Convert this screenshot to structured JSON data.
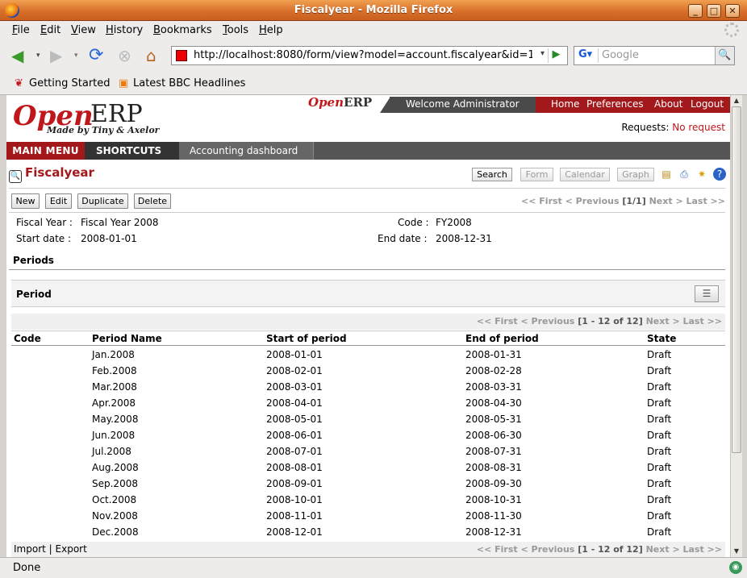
{
  "window": {
    "title": "Fiscalyear - Mozilla Firefox"
  },
  "menubar": [
    "File",
    "Edit",
    "View",
    "History",
    "Bookmarks",
    "Tools",
    "Help"
  ],
  "navigation": {
    "url": "http://localhost:8080/form/view?model=account.fiscalyear&id=1&",
    "search_placeholder": "Google"
  },
  "bookmarks": [
    "Getting Started",
    "Latest BBC Headlines"
  ],
  "header": {
    "logo_open": "Open",
    "logo_erp": "ERP",
    "logo_sub": "Made by Tiny & Axelor",
    "small_logo": "Open",
    "small_logo_erp": "ERP",
    "welcome": "Welcome Administrator",
    "links": [
      "Home",
      "Preferences",
      "About",
      "Logout"
    ],
    "requests_label": "Requests:",
    "requests_value": "No request"
  },
  "mainbar": {
    "main_menu": "MAIN MENU",
    "shortcuts": "SHORTCUTS",
    "shortcut_item": "Accounting dashboard"
  },
  "form": {
    "title": "Fiscalyear",
    "view_buttons": [
      "Search",
      "Form",
      "Calendar",
      "Graph"
    ],
    "actions": [
      "New",
      "Edit",
      "Duplicate",
      "Delete"
    ],
    "pager": {
      "nav_prefix": "<< First < Previous",
      "count": "[1/1]",
      "nav_suffix": "Next > Last >>"
    },
    "fields": {
      "fiscal_year_label": "Fiscal Year :",
      "fiscal_year": "Fiscal Year 2008",
      "code_label": "Code :",
      "code": "FY2008",
      "start_label": "Start date :",
      "start": "2008-01-01",
      "end_label": "End date :",
      "end": "2008-12-31"
    },
    "periods_label": "Periods",
    "period_header": "Period"
  },
  "grid": {
    "pager": {
      "nav_prefix": "<< First < Previous",
      "count": "[1 - 12 of 12]",
      "nav_suffix": "Next > Last >>"
    },
    "columns": [
      "Code",
      "Period Name",
      "Start of period",
      "End of period",
      "State"
    ],
    "rows": [
      {
        "code": "",
        "name": "Jan.2008",
        "start": "2008-01-01",
        "end": "2008-01-31",
        "state": "Draft"
      },
      {
        "code": "",
        "name": "Feb.2008",
        "start": "2008-02-01",
        "end": "2008-02-28",
        "state": "Draft"
      },
      {
        "code": "",
        "name": "Mar.2008",
        "start": "2008-03-01",
        "end": "2008-03-31",
        "state": "Draft"
      },
      {
        "code": "",
        "name": "Apr.2008",
        "start": "2008-04-01",
        "end": "2008-04-30",
        "state": "Draft"
      },
      {
        "code": "",
        "name": "May.2008",
        "start": "2008-05-01",
        "end": "2008-05-31",
        "state": "Draft"
      },
      {
        "code": "",
        "name": "Jun.2008",
        "start": "2008-06-01",
        "end": "2008-06-30",
        "state": "Draft"
      },
      {
        "code": "",
        "name": "Jul.2008",
        "start": "2008-07-01",
        "end": "2008-07-31",
        "state": "Draft"
      },
      {
        "code": "",
        "name": "Aug.2008",
        "start": "2008-08-01",
        "end": "2008-08-31",
        "state": "Draft"
      },
      {
        "code": "",
        "name": "Sep.2008",
        "start": "2008-09-01",
        "end": "2008-09-30",
        "state": "Draft"
      },
      {
        "code": "",
        "name": "Oct.2008",
        "start": "2008-10-01",
        "end": "2008-10-31",
        "state": "Draft"
      },
      {
        "code": "",
        "name": "Nov.2008",
        "start": "2008-11-01",
        "end": "2008-11-30",
        "state": "Draft"
      },
      {
        "code": "",
        "name": "Dec.2008",
        "start": "2008-12-01",
        "end": "2008-12-31",
        "state": "Draft"
      }
    ],
    "footer": {
      "import": "Import",
      "sep": "|",
      "export": "Export"
    }
  },
  "status": {
    "text": "Done"
  }
}
